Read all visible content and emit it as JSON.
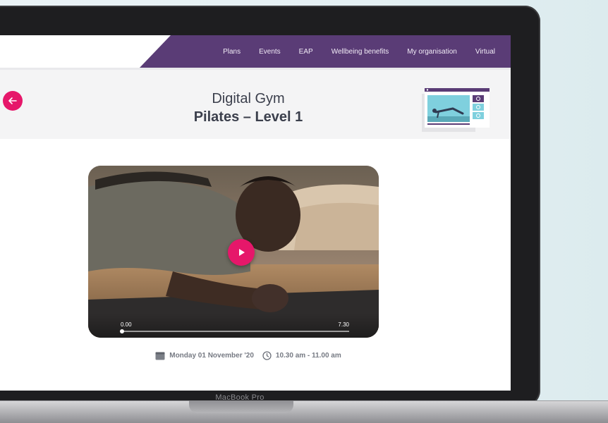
{
  "nav": {
    "items": [
      "Plans",
      "Events",
      "EAP",
      "Wellbeing benefits",
      "My organisation",
      "Virtual"
    ]
  },
  "header": {
    "subtitle": "Digital Gym",
    "title": "Pilates – Level 1"
  },
  "video": {
    "time_current": "0.00",
    "time_total": "7.30",
    "progress": 0
  },
  "meta": {
    "date": "Monday 01 November '20",
    "time": "10.30 am - 11.00 am"
  },
  "device": {
    "label": "MacBook Pro"
  },
  "colors": {
    "accent": "#e6176a",
    "nav_bg": "#5a3c76",
    "title_text": "#3b3f4c"
  },
  "icons": {
    "back": "arrow-left-icon",
    "play": "play-icon",
    "calendar": "calendar-icon",
    "clock": "clock-icon"
  }
}
